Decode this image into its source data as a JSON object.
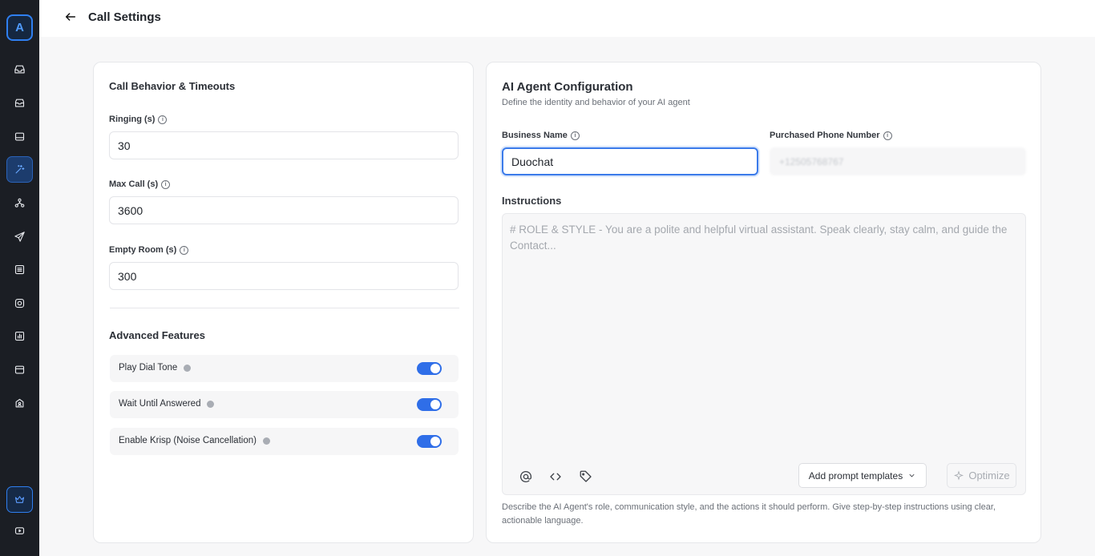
{
  "app": {
    "logo_letter": "A"
  },
  "header": {
    "title": "Call Settings"
  },
  "left_card": {
    "title": "Call Behavior & Timeouts",
    "fields": [
      {
        "label": "Ringing (s)",
        "value": "30"
      },
      {
        "label": "Max Call (s)",
        "value": "3600"
      },
      {
        "label": "Empty Room (s)",
        "value": "300"
      }
    ],
    "advanced_title": "Advanced Features",
    "toggles": [
      {
        "label": "Play Dial Tone",
        "on": true
      },
      {
        "label": "Wait Until Answered",
        "on": true
      },
      {
        "label": "Enable Krisp (Noise Cancellation)",
        "on": true
      }
    ]
  },
  "right_card": {
    "title": "AI Agent Configuration",
    "subtitle": "Define the identity and behavior of your AI agent",
    "business_name_label": "Business Name",
    "business_name_value": "Duochat",
    "phone_label": "Purchased Phone Number",
    "phone_value": "+12505768767",
    "instructions_label": "Instructions",
    "instructions_placeholder": "# ROLE & STYLE - You are a polite and helpful virtual assistant. Speak clearly, stay calm, and guide the Contact...",
    "templates_button": "Add prompt templates",
    "optimize_button": "Optimize",
    "help_text": "Describe the AI Agent's role, communication style, and the actions it should perform. Give step-by-step instructions using clear, actionable language."
  },
  "colors": {
    "accent": "#2f6ee8",
    "sidebar_bg": "#1b1e24",
    "page_bg": "#f7f7f8"
  }
}
